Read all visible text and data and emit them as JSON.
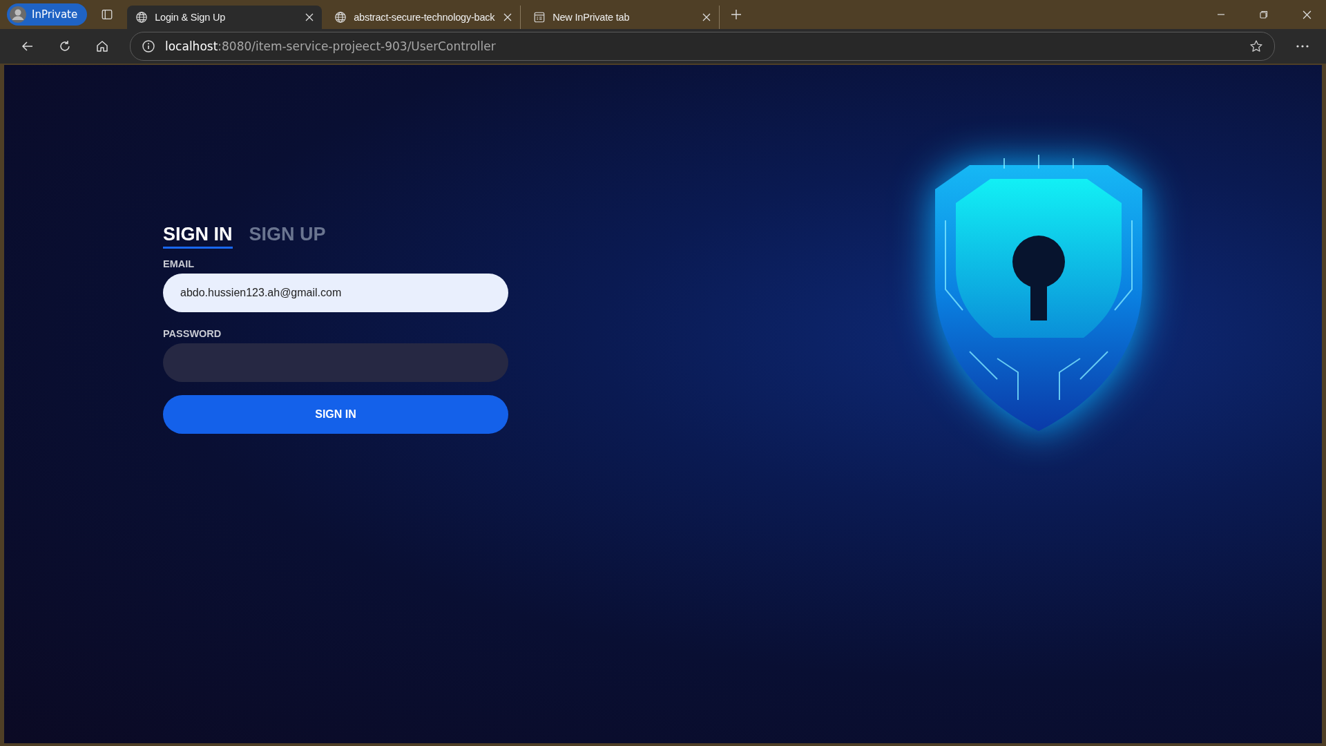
{
  "browser": {
    "profile": "InPrivate",
    "tabs": [
      {
        "kind": "globe",
        "title": "Login & Sign Up",
        "selected": true
      },
      {
        "kind": "globe",
        "title": "abstract-secure-technology-back",
        "selected": false
      },
      {
        "kind": "page",
        "title": "New InPrivate tab",
        "selected": false
      }
    ],
    "address": {
      "host": "localhost",
      "path": ":8080/item-service-projeect-903/UserController"
    }
  },
  "auth": {
    "tabs": [
      {
        "label": "SIGN IN",
        "selected": true
      },
      {
        "label": "SIGN UP",
        "selected": false
      }
    ],
    "fields": [
      {
        "label": "EMAIL",
        "value": "abdo.hussien123.ah@gmail.com"
      },
      {
        "label": "PASSWORD"
      }
    ],
    "submit": "SIGN IN"
  }
}
